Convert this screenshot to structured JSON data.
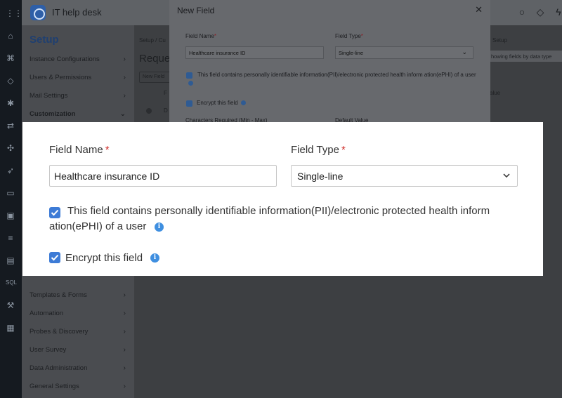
{
  "app": {
    "title": "IT help desk"
  },
  "rail_icons": [
    "grid-icon",
    "home-icon",
    "network-icon",
    "tag-icon",
    "bug-icon",
    "shuffle-icon",
    "puzzle-icon",
    "rocket-icon",
    "book-icon",
    "box-icon",
    "database-icon",
    "report-icon",
    "sql-icon",
    "tools-icon",
    "calendar-icon"
  ],
  "sidebar": {
    "title": "Setup",
    "items_top": [
      {
        "label": "Instance Configurations"
      },
      {
        "label": "Users & Permissions"
      },
      {
        "label": "Mail Settings"
      },
      {
        "label": "Customization"
      }
    ],
    "items_bottom": [
      {
        "label": "Templates & Forms"
      },
      {
        "label": "Automation"
      },
      {
        "label": "Probes & Discovery"
      },
      {
        "label": "User Survey"
      },
      {
        "label": "Data Administration"
      },
      {
        "label": "General Settings"
      }
    ]
  },
  "main": {
    "breadcrumb": "Setup / Cu",
    "page_title": "Reques",
    "new_button": "New Field",
    "column_hint": "F",
    "row_hint": "D",
    "right_crumb": "Setup",
    "filter_hint": "howing fields by data type",
    "value_col": "alue"
  },
  "modal": {
    "title": "New Field",
    "field_name_label": "Field Name",
    "field_name_value": "Healthcare insurance ID",
    "field_type_label": "Field Type",
    "field_type_value": "Single-line",
    "pii_text": "This field contains personally identifiable information(PII)/electronic protected health inform ation(ePHI) of a user",
    "encrypt_text": "Encrypt this field",
    "chars_label": "Characters Required (Min - Max)",
    "default_label": "Default Value"
  },
  "callout": {
    "field_name_label": "Field Name",
    "required_mark": "*",
    "field_name_value": "Healthcare insurance ID",
    "field_type_label": "Field Type",
    "field_type_value": "Single-line",
    "pii_line1": "This field contains personally identifiable information(PII)/electronic protected health inform",
    "pii_line2": "ation(ePHI) of a user",
    "encrypt_text": "Encrypt this field",
    "info_glyph": "i"
  },
  "colors": {
    "accent": "#3d7bd6",
    "required": "#d0312d",
    "info": "#3f8fe0"
  }
}
